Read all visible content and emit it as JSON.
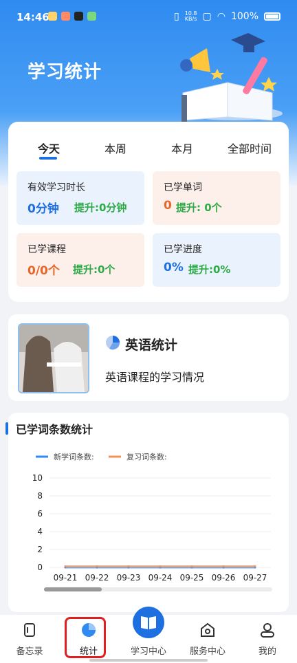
{
  "status_bar": {
    "time": "14:46",
    "net_speed_top": "10.8",
    "net_speed_bottom": "KB/s",
    "battery": "100%"
  },
  "header": {
    "title": "学习统计"
  },
  "tabs": [
    {
      "label": "今天",
      "active": true
    },
    {
      "label": "本周",
      "active": false
    },
    {
      "label": "本月",
      "active": false
    },
    {
      "label": "全部时间",
      "active": false
    }
  ],
  "metrics": [
    {
      "label": "有效学习时长",
      "value": "0分钟",
      "boost": "提升:0分钟",
      "bg": "#eaf2fd",
      "value_color": "#1e6fe0"
    },
    {
      "label": "已学单词",
      "value": "0",
      "boost": "提升: 0个",
      "bg": "#fdf0ea",
      "value_color": "#e8662a"
    },
    {
      "label": "已学课程",
      "value": "0/0个",
      "boost": "提升:0个",
      "bg": "#fdf0ea",
      "value_color": "#e8662a"
    },
    {
      "label": "已学进度",
      "value": "0%",
      "boost": "提升:0%",
      "bg": "#eaf2fd",
      "value_color": "#1e6fe0"
    }
  ],
  "english_card": {
    "title": "英语统计",
    "description": "英语课程的学习情况"
  },
  "chart_section": {
    "title": "已学词条数统计"
  },
  "chart_data": {
    "type": "line",
    "categories": [
      "09-21",
      "09-22",
      "09-23",
      "09-24",
      "09-25",
      "09-26",
      "09-27"
    ],
    "series": [
      {
        "name": "新学词条数:",
        "color": "#2f8bf0",
        "values": [
          0,
          0,
          0,
          0,
          0,
          0,
          0
        ]
      },
      {
        "name": "复习词条数:",
        "color": "#f0925a",
        "values": [
          0,
          0,
          0,
          0,
          0,
          0,
          0
        ]
      }
    ],
    "ylim": [
      0,
      10
    ],
    "yticks": [
      "0",
      "2",
      "4",
      "6",
      "8",
      "10"
    ],
    "grid": true,
    "legend": "top-left",
    "scroll_position": 0.0
  },
  "bottom_nav": [
    {
      "label": "备忘录",
      "icon": "memo-icon"
    },
    {
      "label": "统计",
      "icon": "pie-chart-icon"
    },
    {
      "label": "学习中心",
      "icon": "book-icon"
    },
    {
      "label": "服务中心",
      "icon": "service-icon"
    },
    {
      "label": "我的",
      "icon": "user-icon"
    }
  ],
  "colors": {
    "primary": "#1e6fe0",
    "green": "#2eab48",
    "orange": "#e8662a"
  }
}
